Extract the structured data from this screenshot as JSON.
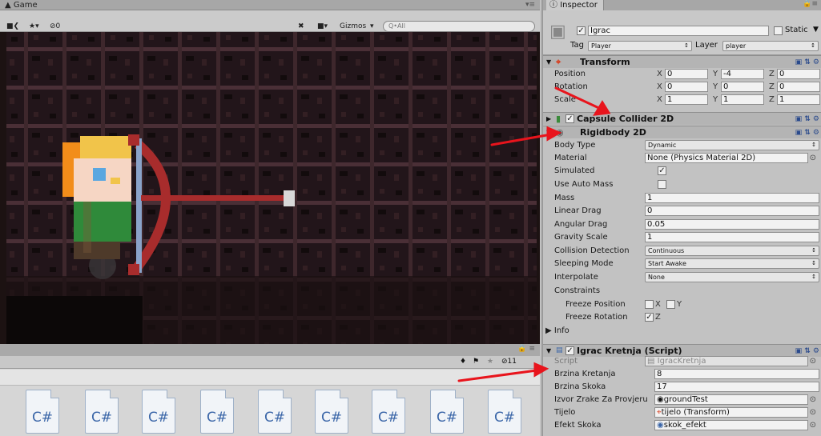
{
  "game": {
    "tab_label": "Game",
    "gizmos_label": "Gizmos",
    "search_placeholder": "Q•All",
    "muted_count": "0"
  },
  "project": {
    "hidden_count": "11",
    "assets": [
      "C#",
      "C#",
      "C#",
      "C#",
      "C#",
      "C#",
      "C#",
      "C#",
      "C#"
    ]
  },
  "inspector": {
    "tab_label": "Inspector",
    "object_name": "Igrac",
    "static_label": "Static",
    "tag_label": "Tag",
    "tag_value": "Player",
    "layer_label": "Layer",
    "layer_value": "player",
    "transform": {
      "title": "Transform",
      "position_label": "Position",
      "px": "0",
      "py": "-4",
      "pz": "0",
      "rotation_label": "Rotation",
      "rx": "0",
      "ry": "0",
      "rz": "0",
      "scale_label": "Scale",
      "sx": "1",
      "sy": "1",
      "sz": "1"
    },
    "capsule": {
      "title": "Capsule Collider 2D"
    },
    "rigidbody": {
      "title": "Rigidbody 2D",
      "body_type_label": "Body Type",
      "body_type": "Dynamic",
      "material_label": "Material",
      "material": "None (Physics Material 2D)",
      "simulated_label": "Simulated",
      "auto_mass_label": "Use Auto Mass",
      "mass_label": "Mass",
      "mass": "1",
      "linear_drag_label": "Linear Drag",
      "linear_drag": "0",
      "angular_drag_label": "Angular Drag",
      "angular_drag": "0.05",
      "gravity_label": "Gravity Scale",
      "gravity": "1",
      "collision_label": "Collision Detection",
      "collision": "Continuous",
      "sleeping_label": "Sleeping Mode",
      "sleeping": "Start Awake",
      "interpolate_label": "Interpolate",
      "interpolate": "None",
      "constraints_label": "Constraints",
      "freeze_pos_label": "Freeze Position",
      "freeze_rot_label": "Freeze Rotation",
      "x": "X",
      "y": "Y",
      "z": "Z"
    },
    "info_label": "Info",
    "script": {
      "title": "Igrac Kretnja (Script)",
      "script_label": "Script",
      "script_value": "IgracKretnja",
      "speed_label": "Brzina Kretanja",
      "speed": "8",
      "jump_label": "Brzina Skoka",
      "jump": "17",
      "ray_label": "Izvor Zrake Za Provjeru",
      "ray": "groundTest",
      "body_label": "Tijelo",
      "body": "tijelo (Transform)",
      "effect_label": "Efekt Skoka",
      "effect": "skok_efekt"
    }
  },
  "colors": {
    "annotation_arrow": "#e8141c",
    "scene_bg": "#2a1a1c",
    "script_icon": "#3b66a8"
  }
}
